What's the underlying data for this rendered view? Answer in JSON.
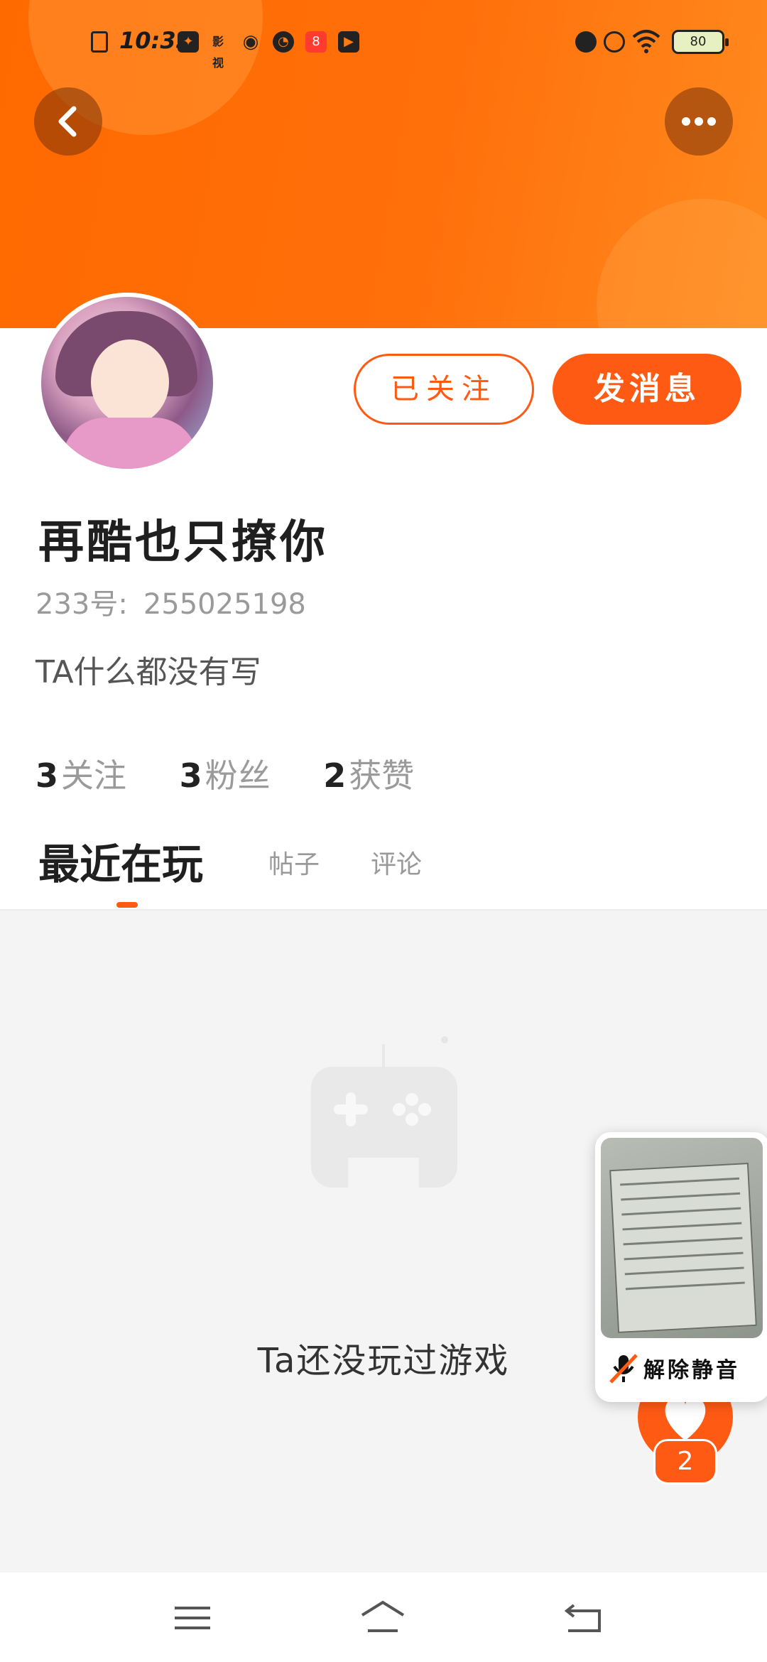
{
  "status_bar": {
    "time": "10:35",
    "battery": "80",
    "left_icons": [
      "sim-icon",
      "app-icon",
      "video-app-icon",
      "weibo-icon",
      "speed-icon",
      "app-store-icon",
      "play-icon"
    ],
    "right_icons": [
      "alarm-icon",
      "mute-notification-icon",
      "wifi-icon",
      "battery-icon"
    ]
  },
  "header": {
    "back_icon": "chevron-left-icon",
    "more_icon": "more-dots-icon",
    "banner_color": "#ff6a00"
  },
  "profile": {
    "username": "再酷也只撩你",
    "id_label": "233号:",
    "id_value": "255025198",
    "bio": "TA什么都没有写",
    "followed_label": "已关注",
    "message_label": "发消息"
  },
  "stats": [
    {
      "num": "3",
      "label": "关注"
    },
    {
      "num": "3",
      "label": "粉丝"
    },
    {
      "num": "2",
      "label": "获赞"
    }
  ],
  "tabs": [
    {
      "label": "最近在玩",
      "active": true
    },
    {
      "label": "帖子",
      "active": false
    },
    {
      "label": "评论",
      "active": false
    }
  ],
  "empty_state": {
    "icon": "gamepad-icon",
    "text": "Ta还没玩过游戏"
  },
  "like": {
    "icon": "heart-icon",
    "count": "2"
  },
  "pip": {
    "unmute_label": "解除静音",
    "mic_icon": "mic-off-icon"
  },
  "nav": {
    "menu_icon": "menu-icon",
    "home_icon": "home-icon",
    "back_icon": "back-icon"
  },
  "colors": {
    "accent": "#ff5a14",
    "background_empty": "#f4f4f4"
  }
}
